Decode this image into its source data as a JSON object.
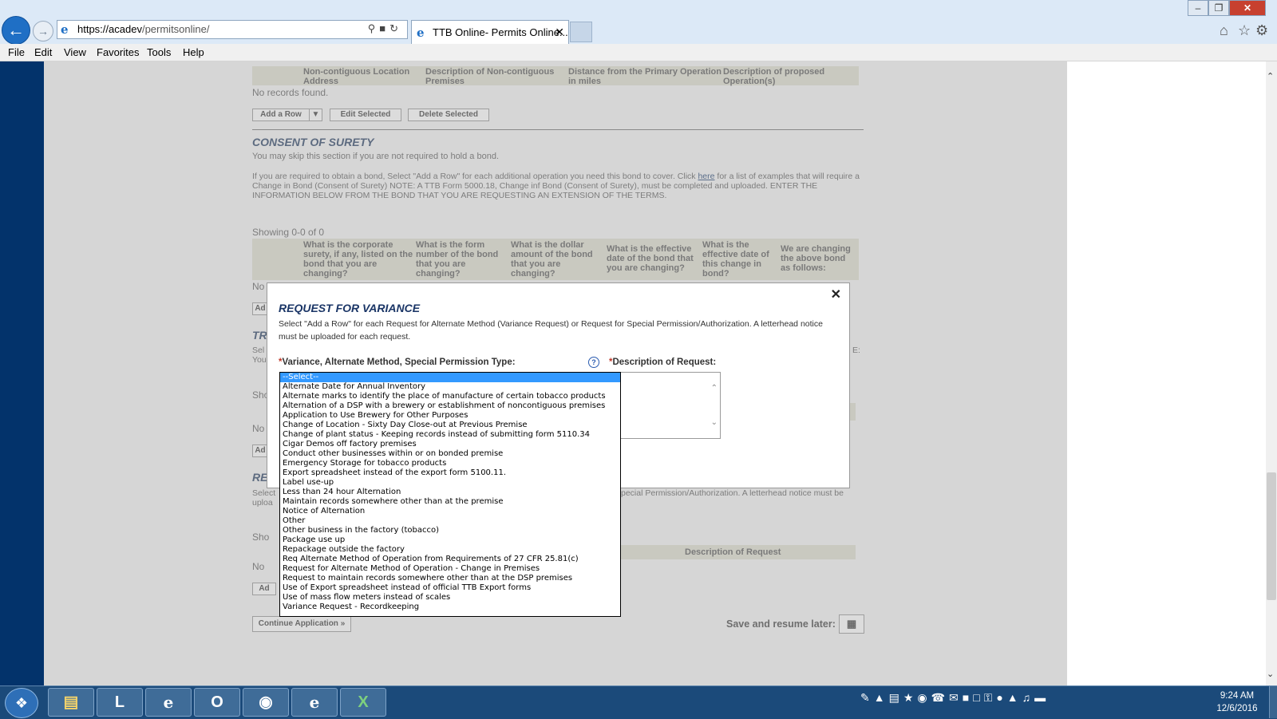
{
  "browser": {
    "url_scheme": "https://",
    "url_host": "acadev",
    "url_path": "/permitsonline/",
    "tab_title": "TTB Online- Permits Online...",
    "tab_close": "✕",
    "win_min": "–",
    "win_max": "❐",
    "win_close": "✕"
  },
  "menu": [
    "File",
    "Edit",
    "View",
    "Favorites",
    "Tools",
    "Help"
  ],
  "page": {
    "noncontig_headers": [
      "Non-contiguous Location Address",
      "Description of Non-contiguous Premises",
      "Distance from the Primary Operation in miles",
      "Description of proposed Operation(s)"
    ],
    "no_records": "No records found.",
    "btn_add_row": "Add a Row",
    "btn_edit_selected": "Edit Selected",
    "btn_delete_selected": "Delete Selected",
    "consent_title": "CONSENT OF SURETY",
    "consent_skip": "You may skip this section if you are not required to hold a bond.",
    "consent_text_a": "If you are required to obtain a bond, Select \"Add a Row\" for each additional operation you need this bond to cover. Click ",
    "consent_link": "here",
    "consent_text_b": " for a list of examples that will require a Change in Bond (Consent of Surety) NOTE: A TTB Form 5000.18, Change inf Bond (Consent of Surety), must be completed and uploaded. ENTER THE INFORMATION BELOW FROM THE BOND THAT YOU ARE REQUESTING AN EXTENSION OF THE TERMS.",
    "showing": "Showing 0-0 of 0",
    "surety_headers": [
      "What is the corporate surety, if any, listed on the bond that you are changing?",
      "What is the form number of the bond that you are changing?",
      "What is the dollar amount of the bond that you are changing?",
      "What is the effective date of the bond that you are changing?",
      "What is the effective date of this change in bond?",
      "We are changing the above bond as follows:"
    ],
    "frag_no": "No",
    "frag_ad": "Ad",
    "frag_tr": "TR",
    "frag_sel": "Sel",
    "frag_you": "You",
    "frag_sho": "Sho",
    "frag_e_colon": "E:",
    "frag_re": "RE",
    "frag_select": "Select",
    "frag_uploa": "uploa",
    "variance_right_text": "pecial Permission/Authorization. A letterhead notice must be",
    "desc_header": "Description of Request",
    "continue_btn": "Continue Application »",
    "save_later": "Save and resume later:"
  },
  "modal": {
    "title": "REQUEST FOR VARIANCE",
    "close": "✕",
    "intro": "Select \"Add a Row\" for each Request for Alternate Method (Variance Request) or Request for Special Permission/Authorization. A letterhead notice must be uploaded for each request.",
    "required_mark": "*",
    "type_label": "Variance, Alternate Method, Special Permission Type:",
    "help": "?",
    "desc_label": "Description of Request:"
  },
  "dropdown_options": [
    "--Select--",
    "Alternate Date for Annual Inventory",
    "Alternate marks to identify the place of manufacture of certain tobacco products",
    "Alternation of a DSP with a brewery or establishment of noncontiguous premises",
    "Application to Use Brewery for Other Purposes",
    "Change of Location - Sixty Day Close-out at Previous Premise",
    "Change of plant status - Keeping records instead of submitting form 5110.34",
    "Cigar Demos off factory premises",
    "Conduct other businesses within or on bonded premise",
    "Emergency Storage for tobacco products",
    "Export spreadsheet instead of the export form 5100.11.",
    "Label use-up",
    "Less than 24 hour Alternation",
    "Maintain records somewhere other than at the premise",
    "Notice of Alternation",
    "Other",
    "Other business in the factory (tobacco)",
    "Package use up",
    "Repackage outside the factory",
    "Req Alternate Method of Operation from Requirements of 27 CFR 25.81(c)",
    "Request for Alternate Method of Operation - Change in Premises",
    "Request to maintain records somewhere other than at the DSP premises",
    "Use of Export spreadsheet instead of official TTB Export forms",
    "Use of mass flow meters instead of scales",
    "Variance Request - Recordkeeping"
  ],
  "taskbar": {
    "time": "9:24 AM",
    "date": "12/6/2016"
  },
  "icons": [
    "back-icon",
    "forward-icon",
    "search-icon",
    "lock-icon",
    "refresh-icon",
    "home-icon",
    "favorites-star-icon",
    "gear-icon",
    "windows-start-icon",
    "calendar-icon"
  ]
}
